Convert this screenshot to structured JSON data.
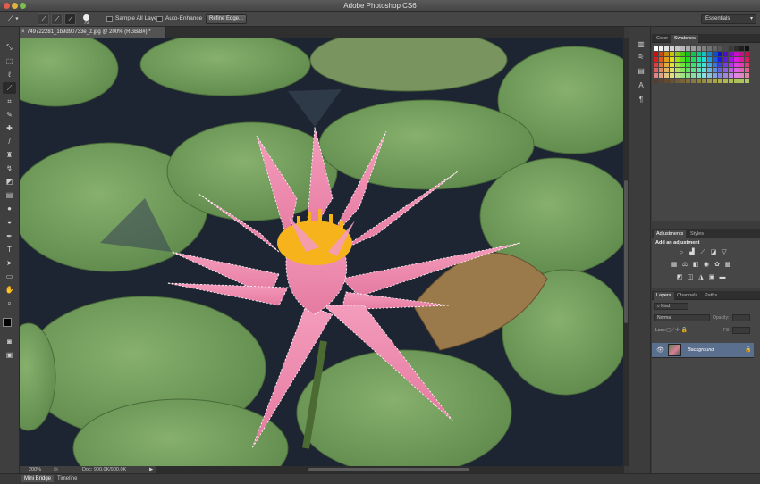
{
  "window": {
    "title": "Adobe Photoshop CS6"
  },
  "options_bar": {
    "brush_size": "70",
    "sample_all_layers_label": "Sample All Layers",
    "auto_enhance_label": "Auto-Enhance",
    "refine_edge_label": "Refine Edge...",
    "workspace": "Essentials"
  },
  "document": {
    "tab_label": "749722281_1b9d90733e_z.jpg @ 200% (RGB/8#) *",
    "zoom": "200%",
    "doc_size": "Doc: 900.0K/900.0K"
  },
  "panels": {
    "color_tabs": [
      "Color",
      "Swatches"
    ],
    "adjustments_tabs": [
      "Adjustments",
      "Styles"
    ],
    "adjustments_hint": "Add an adjustment",
    "layers_tabs": [
      "Layers",
      "Channels",
      "Paths"
    ],
    "kind_filter": "Kind",
    "blend_mode": "Normal",
    "opacity_label": "Opacity:",
    "lock_label": "Lock:",
    "fill_label": "Fill:",
    "layers": [
      {
        "name": "Background",
        "locked": true,
        "visible": true
      }
    ]
  },
  "bottom_tabs": [
    "Mini Bridge",
    "Timeline"
  ],
  "colors": {
    "ui_dark": "#3a3a3a",
    "pond_water": "#1c2431",
    "lily_pad": "#6f9a5a",
    "lotus_pink": "#f08fb0",
    "stamen_yellow": "#f7b31b",
    "selected_layer": "#5a6e8e"
  },
  "icons": {
    "tools": [
      "move-icon",
      "marquee-icon",
      "lasso-icon",
      "quick-selection-icon",
      "crop-icon",
      "eyedropper-icon",
      "healing-brush-icon",
      "brush-icon",
      "clone-stamp-icon",
      "history-brush-icon",
      "eraser-icon",
      "gradient-icon",
      "blur-icon",
      "dodge-icon",
      "pen-icon",
      "type-icon",
      "path-selection-icon",
      "rectangle-icon",
      "hand-icon",
      "zoom-icon"
    ]
  }
}
